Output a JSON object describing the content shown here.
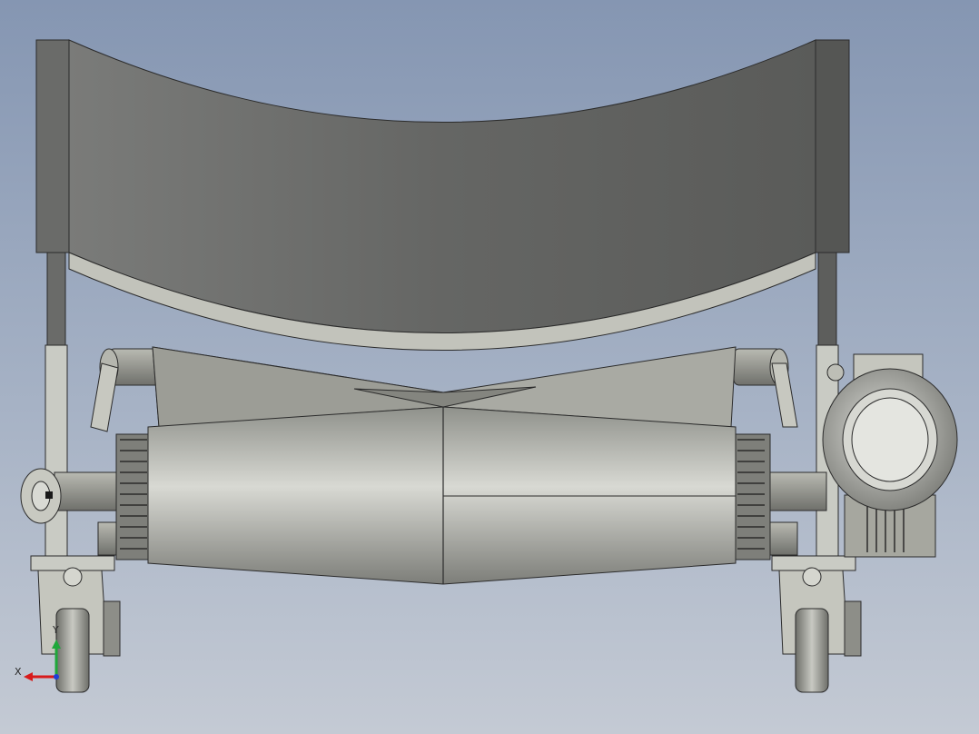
{
  "viewport": {
    "background_top": "#8596b2",
    "background_bottom": "#c4cad4"
  },
  "model": {
    "parts": [
      "belt-shield-icon",
      "left-frame-post-icon",
      "right-frame-post-icon",
      "double-cone-roller-icon",
      "left-sprocket-icon",
      "right-sprocket-icon",
      "drive-motor-icon",
      "left-caster-wheel-icon",
      "right-caster-wheel-icon"
    ],
    "colors": {
      "shield_dark": "#5f605f",
      "shield_light": "#7a7b79",
      "steel": "#c9cbc4",
      "roller_highlight": "#d8d9d3",
      "roller_shadow": "#7d7e79",
      "edge": "#2b2b2b"
    }
  },
  "triad": {
    "x_label": "X",
    "y_label": "Y",
    "x_color": "#d81b1b",
    "y_color": "#1fa83a",
    "z_color": "#1f3fd8"
  }
}
